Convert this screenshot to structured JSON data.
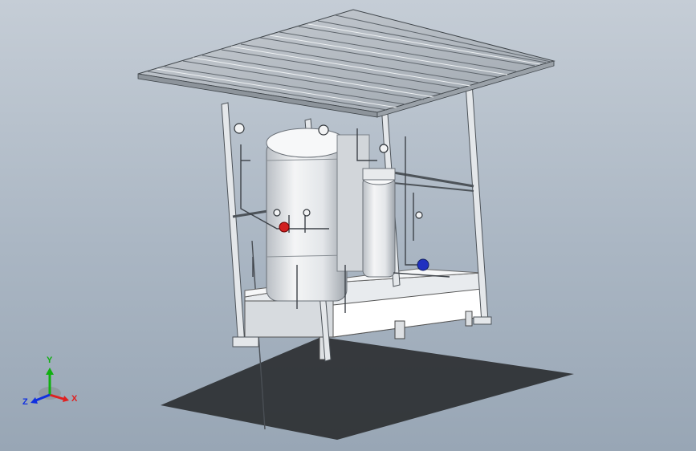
{
  "triad": {
    "x_label": "X",
    "y_label": "Y",
    "z_label": "Z",
    "x_color": "#e02020",
    "y_color": "#10b010",
    "z_color": "#1030e0"
  },
  "scene_colors": {
    "background_top": "#c5cdd6",
    "background_bottom": "#98a6b5",
    "roof": "#d4d9de",
    "frame": "#eceff2",
    "tank": "#e8eaec",
    "shadow": "#2a2c2e",
    "valve_red": "#d02020",
    "valve_blue": "#2030c0"
  },
  "icons": [
    "triad-icon"
  ]
}
